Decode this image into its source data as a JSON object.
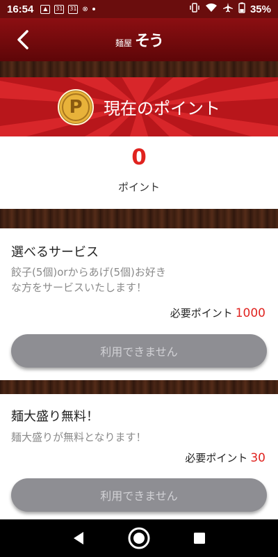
{
  "status_bar": {
    "time": "16:54",
    "calendar_day": "31",
    "battery": "35%"
  },
  "header": {
    "logo_small": "麺屋",
    "logo_main": "そう",
    "back_icon": "chevron-left-icon"
  },
  "points": {
    "banner_title": "現在のポイント",
    "coin_letter": "P",
    "value": "0",
    "unit": "ポイント"
  },
  "services": [
    {
      "title": "選べるサービス",
      "desc_line1": "餃子(5個)orからあげ(5個)お好き",
      "desc_line2": "な方をサービスいたします！",
      "required_label": "必要ポイント",
      "required_points": "1000",
      "button_label": "利用できません"
    },
    {
      "title": "麺大盛り無料！",
      "desc_line1": "麺大盛りが無料となります！",
      "required_label": "必要ポイント",
      "required_points": "30",
      "button_label": "利用できません"
    }
  ],
  "colors": {
    "header_red": "#8c0f12",
    "banner_red": "#d8262a",
    "accent_red": "#e0231f",
    "disabled_button": "#8e8e93"
  }
}
